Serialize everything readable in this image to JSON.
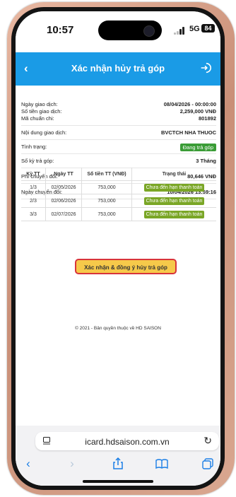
{
  "status": {
    "time": "10:57",
    "network": "5G",
    "battery": "84"
  },
  "header": {
    "title": "Xác nhận hủy trả góp"
  },
  "details": [
    {
      "label": "Ngày giao dịch:",
      "value": "08/04/2026 - 00:00:00"
    },
    {
      "label": "Số tiền giao dịch:",
      "value": "2,259,000 VNĐ"
    },
    {
      "label": "Mã chuẩn chi:",
      "value": "801892"
    },
    {
      "label": "Nội dung giao dịch:",
      "value": "BVCTCH NHA THUOC"
    },
    {
      "label": "Tình trạng:",
      "value": "Đang trả góp"
    },
    {
      "label": "Số kỳ trả góp:",
      "value": "3 Tháng"
    },
    {
      "label": "Phí chuyển đổi:",
      "value": "80,646 VNĐ"
    },
    {
      "label": "Ngày chuyển đổi:",
      "value": "10/04/2026 13:59:16"
    }
  ],
  "table": {
    "headers": [
      "Kỳ TT",
      "Ngày TT",
      "Số tiền TT (VNĐ)",
      "Trạng thái"
    ],
    "rows": [
      {
        "period": "1/3",
        "date": "02/05/2026",
        "amount": "753,000",
        "status": "Chưa đến hạn thanh toán"
      },
      {
        "period": "2/3",
        "date": "02/06/2026",
        "amount": "753,000",
        "status": "Chưa đến hạn thanh toán"
      },
      {
        "period": "3/3",
        "date": "02/07/2026",
        "amount": "753,000",
        "status": "Chưa đến hạn thanh toán"
      }
    ]
  },
  "confirm_label": "Xác nhận & đồng ý hủy trả góp",
  "footer": "© 2021 - Bản quyền thuộc về HD SAISON",
  "browser": {
    "url": "icard.hdsaison.com.vn"
  },
  "colors": {
    "header_blue": "#1a9be6",
    "status_green": "#3a9c36",
    "row_badge_green": "#7aa626",
    "button_yellow": "#f6c94a",
    "button_border_red": "#d8343a"
  }
}
